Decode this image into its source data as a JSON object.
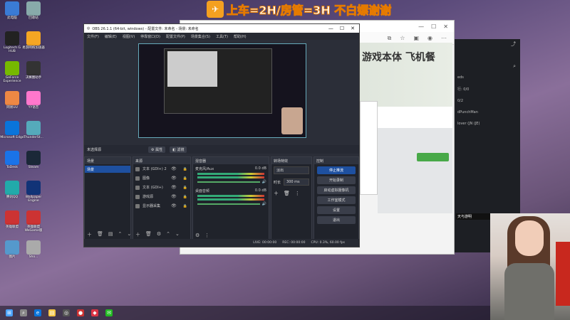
{
  "banner": {
    "text": "上车=2H/房管=3H 不白嫖谢谢"
  },
  "desktop_icons": [
    {
      "label": "此电脑"
    },
    {
      "label": "回收站"
    },
    {
      "label": "Logitech G HUB"
    },
    {
      "label": "易游网络加速器"
    },
    {
      "label": "GeForce Experience"
    },
    {
      "label": "决赛圈助手"
    },
    {
      "label": "网易UU"
    },
    {
      "label": "YY语音"
    },
    {
      "label": "Microsoft Edge"
    },
    {
      "label": "ThunderSt..."
    },
    {
      "label": "ToDesk"
    },
    {
      "label": "Steam"
    },
    {
      "label": "腾讯QQ"
    },
    {
      "label": "Wallpaper Engine"
    },
    {
      "label": "英雄联盟"
    },
    {
      "label": "英雄联盟WeGame版"
    },
    {
      "label": "图片"
    },
    {
      "label": "Sho..."
    }
  ],
  "obs": {
    "title": "OBS 26.1.1 (64-bit, windows) - 配置文件: 未命名 - 场景: 未命名",
    "menu": [
      "文件(F)",
      "编辑(E)",
      "视图(V)",
      "停靠窗口(D)",
      "配置文件(P)",
      "场景集合(S)",
      "工具(T)",
      "帮助(H)"
    ],
    "no_source": "未选择源",
    "props_btn": "属性",
    "filter_btn": "滤镜",
    "scenes": {
      "header": "场景",
      "items": [
        "场景"
      ]
    },
    "sources": {
      "header": "来源",
      "items": [
        "文本 (GDI+) 2",
        "图像",
        "文本 (GDI+)",
        "游戏源",
        "显示器采集"
      ]
    },
    "mixer": {
      "header": "混音器",
      "channels": [
        {
          "name": "麦克风/Aux",
          "db": "0.0 dB"
        },
        {
          "name": "桌面音频",
          "db": "0.0 dB"
        }
      ]
    },
    "transitions": {
      "header": "转场特效",
      "type": "淡出",
      "duration_label": "时长",
      "duration": "300 ms"
    },
    "controls": {
      "header": "控制",
      "buttons": [
        "停止推流",
        "开始录制",
        "启动虚拟摄像机",
        "工作室模式",
        "设置",
        "退出"
      ]
    },
    "status": {
      "live": "LIVE: 00:00:00",
      "rec": "REC: 00:00:00",
      "cpu": "CPU: 0.3%, 60.00 fps"
    }
  },
  "browser": {
    "page_title": "游戏本体 飞机餐"
  },
  "side_panel": {
    "lines": [
      "eds",
      "行: 0/0",
      "0/2",
      "dPunchMan",
      "lover (JN (JE)"
    ]
  },
  "side_label": "天与游明",
  "taskbar": {
    "icons": [
      "windows-icon",
      "search-icon",
      "edge-icon",
      "explorer-icon",
      "obs-icon",
      "record-icon",
      "app-icon",
      "wechat-icon"
    ]
  }
}
